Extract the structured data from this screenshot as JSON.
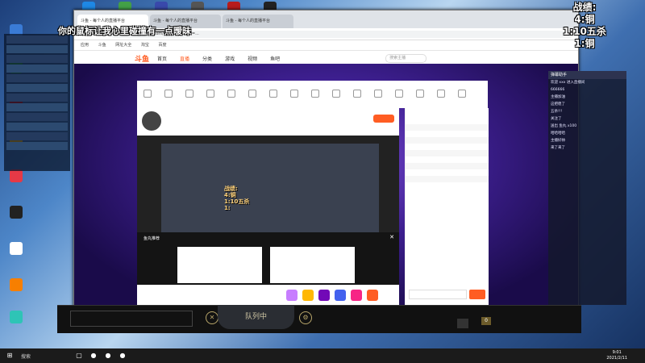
{
  "overlay": {
    "top_caption": "你的鼠标让我心里碰撞有一点暧昧",
    "score_lines": [
      "战绩:",
      "4:铜",
      "1:10五杀",
      "1:铜"
    ]
  },
  "browser": {
    "tabs": [
      "斗鱼 - 每个人的直播平台",
      "斗鱼 - 每个人的直播平台",
      "斗鱼 - 每个人的直播平台"
    ],
    "url": "https://www.douyu.com/topic/xxxx?rid=...",
    "bookmarks": [
      "应用",
      "斗鱼",
      "网址大全",
      "淘宝",
      "百度"
    ],
    "site": {
      "logo": "斗鱼",
      "nav": [
        "首页",
        "直播",
        "分类",
        "游戏",
        "视频",
        "鱼吧"
      ],
      "search_placeholder": "搜索主播"
    },
    "stream_overlay": [
      "战绩:",
      "4:铜",
      "1:10五杀",
      "1:"
    ],
    "recommend_title": "鱼丸推荐"
  },
  "right_chat": {
    "title": "弹幕助手",
    "lines": [
      "欢迎 xxx 进入直播间",
      "666666",
      "主播加油",
      "这把稳了",
      "五杀!!!",
      "关注了",
      "送出 鱼丸 x100",
      "哈哈哈哈",
      "主播好帅",
      "来了来了"
    ]
  },
  "queue": {
    "label": "队列中",
    "number": "0"
  },
  "taskbar": {
    "search": "搜索",
    "time": "9:01",
    "date": "2021/2/11"
  },
  "colors": {
    "brand": "#ff5d23",
    "page_purple": "#3d1f8f"
  }
}
